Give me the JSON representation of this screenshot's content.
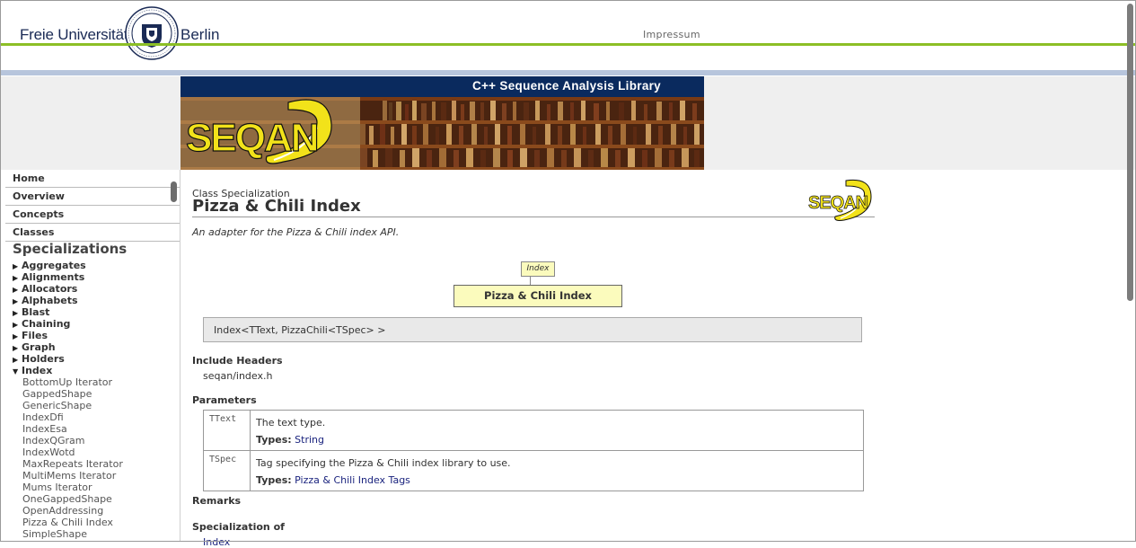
{
  "header": {
    "uni_left": "Freie Universität",
    "uni_right": "Berlin",
    "impressum": "Impressum"
  },
  "banner": {
    "title": "C++ Sequence Analysis Library",
    "logo_text": "SEQAN"
  },
  "nav": {
    "top_links": [
      "Home",
      "Overview",
      "Concepts",
      "Classes"
    ],
    "section": "Specializations",
    "groups": [
      "Aggregates",
      "Alignments",
      "Allocators",
      "Alphabets",
      "Blast",
      "Chaining",
      "Files",
      "Graph",
      "Holders"
    ],
    "expanded_group": "Index",
    "index_items": [
      "BottomUp Iterator",
      "GappedShape",
      "GenericShape",
      "IndexDfi",
      "IndexEsa",
      "IndexQGram",
      "IndexWotd",
      "MaxRepeats Iterator",
      "MultiMems Iterator",
      "Mums Iterator",
      "OneGappedShape",
      "OpenAddressing",
      "Pizza & Chili Index",
      "SimpleShape"
    ]
  },
  "page": {
    "kind": "Class Specialization",
    "title": "Pizza & Chili Index",
    "description": "An adapter for the Pizza & Chili index API.",
    "diagram_parent": "Index",
    "diagram_self": "Pizza & Chili Index",
    "signature": "Index<TText, PizzaChili<TSpec> >",
    "include_header": "Include Headers",
    "include_value": "seqan/index.h",
    "parameters_header": "Parameters",
    "types_label": "Types:",
    "params": [
      {
        "name": "TText",
        "desc": "The text type.",
        "type": "String"
      },
      {
        "name": "TSpec",
        "desc": "Tag specifying the Pizza & Chili index library to use.",
        "type": "Pizza & Chili Index Tags"
      }
    ],
    "remarks_header": "Remarks",
    "specialization_of_header": "Specialization of",
    "specialization_of_value": "Index"
  },
  "colors": {
    "green_rule": "#8cbf26",
    "banner_blue": "#0a2a5e",
    "diagram_yellow": "#fbfbbd",
    "link": "#1a237e"
  }
}
